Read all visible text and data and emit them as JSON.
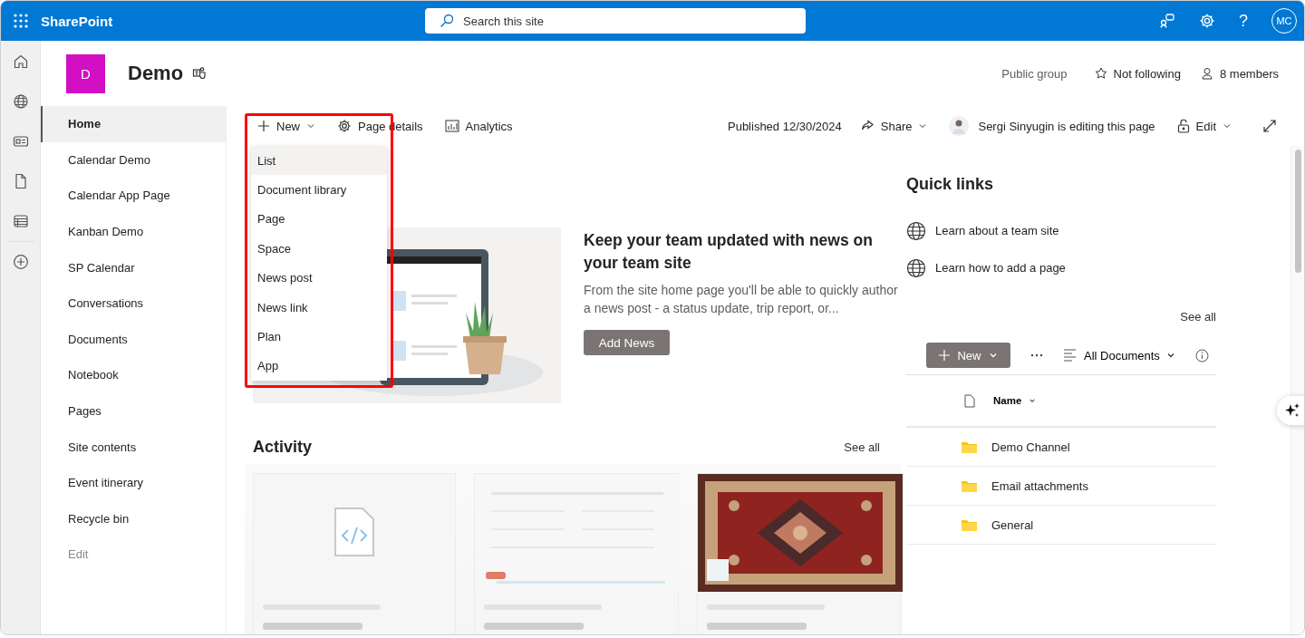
{
  "topbar": {
    "app_name": "SharePoint",
    "search": {
      "placeholder": "Search this site"
    },
    "help": "?",
    "avatar": "MC"
  },
  "site": {
    "logo_letter": "D",
    "title": "Demo",
    "privacy": "Public group",
    "follow": "Not following",
    "members": "8 members"
  },
  "nav": [
    {
      "label": "Home",
      "selected": true
    },
    {
      "label": "Calendar Demo",
      "selected": false
    },
    {
      "label": "Calendar App Page",
      "selected": false
    },
    {
      "label": "Kanban Demo",
      "selected": false
    },
    {
      "label": "SP Calendar",
      "selected": false
    },
    {
      "label": "Conversations",
      "selected": false
    },
    {
      "label": "Documents",
      "selected": false
    },
    {
      "label": "Notebook",
      "selected": false
    },
    {
      "label": "Pages",
      "selected": false
    },
    {
      "label": "Site contents",
      "selected": false
    },
    {
      "label": "Event itinerary",
      "selected": false
    },
    {
      "label": "Recycle bin",
      "selected": false
    }
  ],
  "nav_edit": "Edit",
  "command_bar": {
    "new": "New",
    "page_details": "Page details",
    "analytics": "Analytics",
    "published": "Published 12/30/2024",
    "share": "Share",
    "editing": "Sergi Sinyugin is editing this page",
    "edit": "Edit"
  },
  "new_menu": [
    {
      "label": "List",
      "selected": true
    },
    {
      "label": "Document library",
      "selected": false
    },
    {
      "label": "Page",
      "selected": false
    },
    {
      "label": "Space",
      "selected": false
    },
    {
      "label": "News post",
      "selected": false
    },
    {
      "label": "News link",
      "selected": false
    },
    {
      "label": "Plan",
      "selected": false
    },
    {
      "label": "App",
      "selected": false
    }
  ],
  "news": {
    "title": "Keep your team updated with news on your team site",
    "body": "From the site home page you'll be able to quickly author a news post - a status update, trip report, or...",
    "button": "Add News"
  },
  "activity": {
    "title": "Activity",
    "see_all": "See all",
    "cards": [
      {
        "kind": "file"
      },
      {
        "kind": "form"
      },
      {
        "kind": "picture"
      }
    ]
  },
  "quick_links": {
    "title": "Quick links",
    "links": [
      "Learn about a team site",
      "Learn how to add a page"
    ]
  },
  "documents": {
    "see_all": "See all",
    "new": "New",
    "view": "All Documents",
    "column": "Name",
    "rows": [
      "Demo Channel",
      "Email attachments",
      "General"
    ]
  }
}
